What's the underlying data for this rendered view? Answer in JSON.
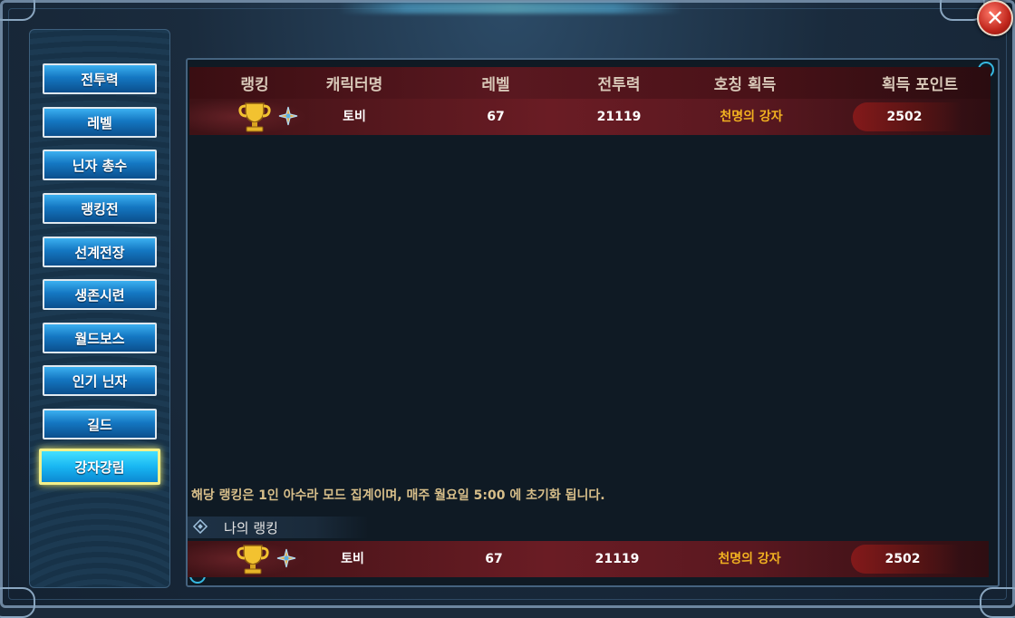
{
  "window": {
    "close_label": "✕"
  },
  "sidebar": {
    "items": [
      {
        "label": "전투력",
        "active": false
      },
      {
        "label": "레벨",
        "active": false
      },
      {
        "label": "닌자 총수",
        "active": false
      },
      {
        "label": "랭킹전",
        "active": false
      },
      {
        "label": "선계전장",
        "active": false
      },
      {
        "label": "생존시련",
        "active": false
      },
      {
        "label": "월드보스",
        "active": false
      },
      {
        "label": "인기 닌자",
        "active": false
      },
      {
        "label": "길드",
        "active": false
      },
      {
        "label": "강자강림",
        "active": true
      }
    ]
  },
  "table": {
    "headers": {
      "rank": "랭킹",
      "name": "캐릭터명",
      "level": "레벨",
      "power": "전투력",
      "title": "호칭 획득",
      "points": "획득 포인트"
    },
    "rows": [
      {
        "rank_icon": "trophy-icon",
        "name": "토비",
        "level": "67",
        "power": "21119",
        "title": "천명의 강자",
        "points": "2502"
      }
    ]
  },
  "notice": "해당 랭킹은 1인 아수라 모드 집계이며, 매주 월요일 5:00 에 초기화 됩니다.",
  "my_ranking": {
    "label": "나의 랭킹",
    "row": {
      "rank_icon": "trophy-icon",
      "name": "토비",
      "level": "67",
      "power": "21119",
      "title": "천명의 강자",
      "points": "2502"
    }
  },
  "colors": {
    "button_blue": "#1477c2",
    "active_border": "#f4f08a",
    "title_gold": "#f0b020",
    "row_red": "#6a1c24",
    "close_red": "#c0261c"
  }
}
